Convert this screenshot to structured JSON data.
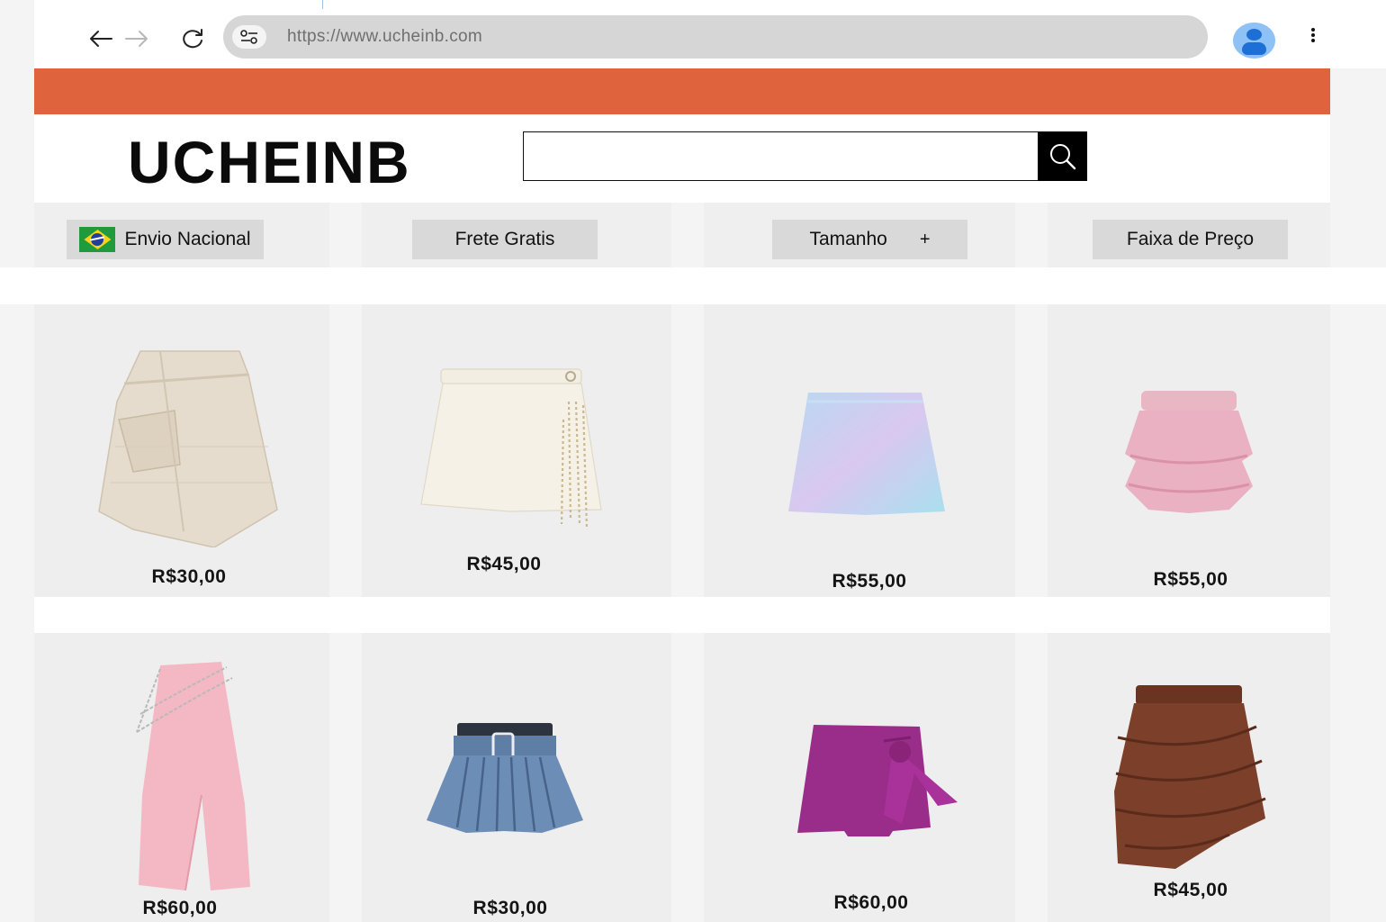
{
  "browser": {
    "url": "https://www.ucheinb.com"
  },
  "site": {
    "logo": "UCHEINB",
    "promo_bar_color": "#df643d",
    "search": {
      "value": "",
      "placeholder": ""
    }
  },
  "filters": [
    {
      "label": "Envio Nacional",
      "icon": "brazil-flag-icon"
    },
    {
      "label": "Frete Gratis"
    },
    {
      "label": "Tamanho",
      "suffix": "+"
    },
    {
      "label": "Faixa de Preço"
    }
  ],
  "products": [
    {
      "item": "beige tweed wrap skirt",
      "price": "R$30,00"
    },
    {
      "item": "cream tweed skirt with pearl fringe",
      "price": "R$45,00"
    },
    {
      "item": "iridescent blue sequin mini skirt",
      "price": "R$55,00"
    },
    {
      "item": "pink sequin ruffle skirt",
      "price": "R$55,00"
    },
    {
      "item": "pink satin midi skirt with chain belt",
      "price": "R$60,00"
    },
    {
      "item": "denim pleated mini skirt",
      "price": "R$30,00"
    },
    {
      "item": "purple bow wrap skort",
      "price": "R$60,00"
    },
    {
      "item": "brown ruched leather skirt",
      "price": "R$45,00"
    }
  ],
  "colors": {
    "accent": "#df643d",
    "card_bg": "#eeeeee",
    "filter_button_bg": "#d9d9d9",
    "avatar": "#1d6fd6"
  }
}
